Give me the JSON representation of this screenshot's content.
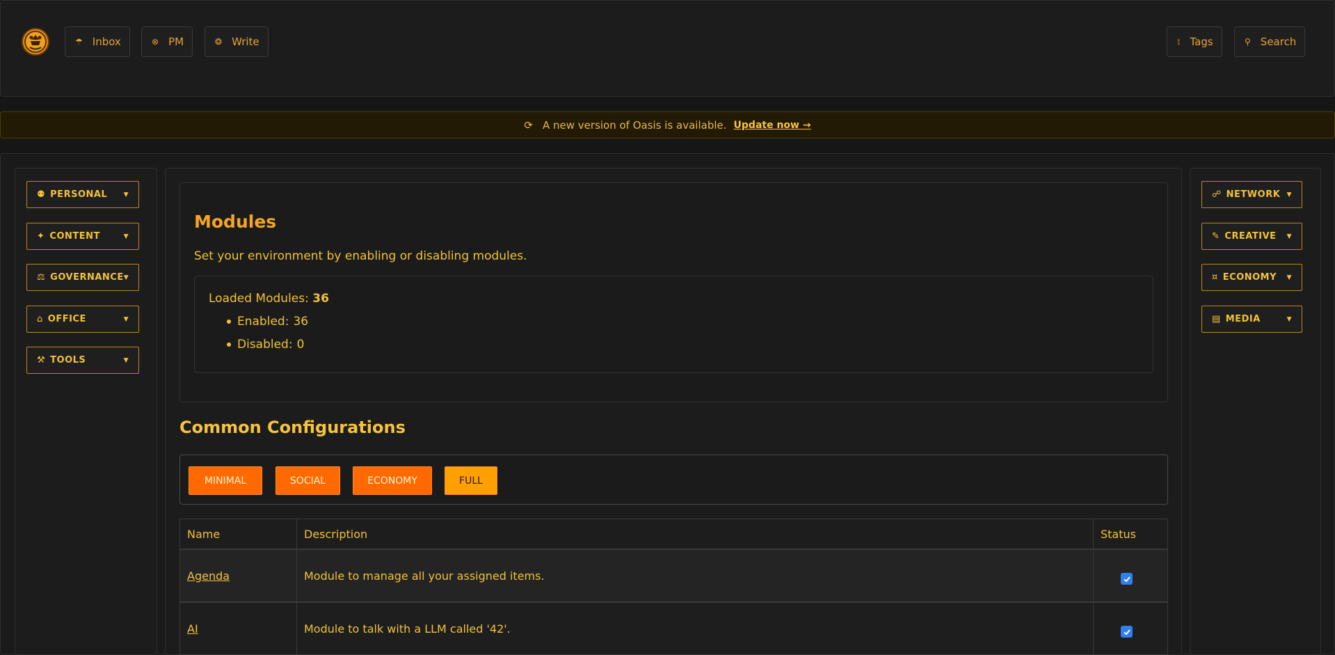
{
  "topbar": {
    "buttons": [
      {
        "icon": "☂",
        "label": "Inbox"
      },
      {
        "icon": "⊗",
        "label": "PM"
      },
      {
        "icon": "❂",
        "label": "Write"
      },
      {
        "icon": "⟟",
        "label": "Tags"
      },
      {
        "icon": "⚲",
        "label": "Search"
      }
    ]
  },
  "banner": {
    "icon": "⟳",
    "text": "A new version of Oasis is available.",
    "link": "Update now →"
  },
  "left_menu": [
    {
      "icon": "⚉",
      "label": "PERSONAL",
      "caret": "▼"
    },
    {
      "icon": "✦",
      "label": "CONTENT",
      "caret": "▼"
    },
    {
      "icon": "⚖",
      "label": "GOVERNANCE",
      "caret": "▼"
    },
    {
      "icon": "⌂",
      "label": "OFFICE",
      "caret": "▼"
    },
    {
      "icon": "⚒",
      "label": "TOOLS",
      "caret": "▼"
    }
  ],
  "right_menu": [
    {
      "icon": "☍",
      "label": "NETWORK",
      "caret": "▼"
    },
    {
      "icon": "✎",
      "label": "CREATIVE",
      "caret": "▼"
    },
    {
      "icon": "¤",
      "label": "ECONOMY",
      "caret": "▼"
    },
    {
      "icon": "▤",
      "label": "MEDIA",
      "caret": "▼"
    }
  ],
  "modules": {
    "title": "Modules",
    "description": "Set your environment by enabling or disabling modules.",
    "loaded_label": "Loaded Modules:",
    "loaded_value": "36",
    "enabled_label": "Enabled:",
    "enabled_value": "36",
    "disabled_label": "Disabled:",
    "disabled_value": "0"
  },
  "configs": {
    "title": "Common Configurations",
    "buttons": [
      "MINIMAL",
      "SOCIAL",
      "ECONOMY",
      "FULL"
    ]
  },
  "table": {
    "headers": [
      "Name",
      "Description",
      "Status"
    ],
    "rows": [
      {
        "name": "Agenda",
        "description": "Module to manage all your assigned items.",
        "enabled": true
      },
      {
        "name": "AI",
        "description": "Module to talk with a LLM called '42'.",
        "enabled": true
      }
    ]
  },
  "colors": {
    "accent": "#f2c23a",
    "config_button": "#ff6a00",
    "config_button_active": "#ffa000",
    "checkbox": "#2f7ff0"
  }
}
